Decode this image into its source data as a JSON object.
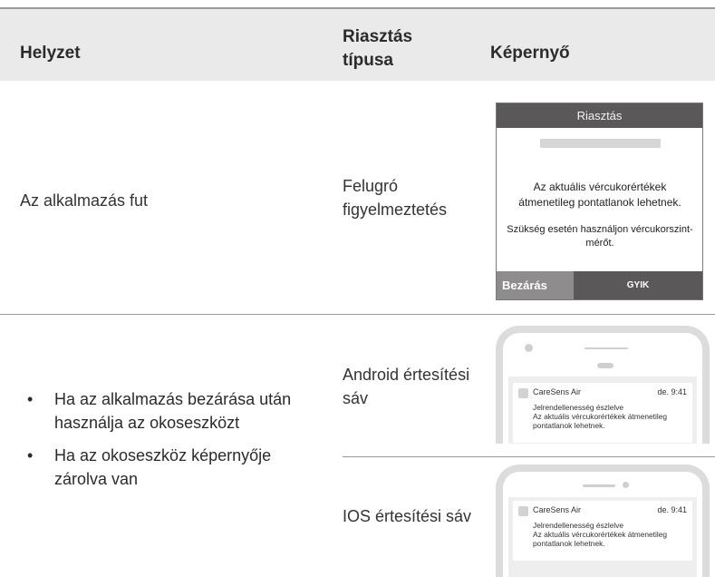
{
  "header": {
    "col1": "Helyzet",
    "col2": "Riasztás típusa",
    "col3": "Képernyő"
  },
  "row1": {
    "situation": "Az alkalmazás fut",
    "alert_type": "Felugró figyelmeztetés",
    "dialog": {
      "title": "Riasztás",
      "message1": "Az aktuális vércukorértékek átmenetileg pontatlanok lehetnek.",
      "message2": "Szükség esetén használjon vércukorszint-mérőt.",
      "close_label": "Bezárás",
      "faq_label": "GYIK"
    }
  },
  "row2": {
    "bullets": [
      "Ha az alkalmazás bezárása után használja az okoseszközt",
      "Ha az okoseszköz képernyője zárolva van"
    ],
    "android_type": "Android értesítési sáv",
    "ios_type": "IOS értesítési sáv",
    "notification": {
      "app": "CareSens Air",
      "time": "de. 9:41",
      "line1": "Jelrendellenesség észlelve",
      "line2": "Az aktuális vércukorértékek átmenetileg pontatlanok lehetnek."
    }
  }
}
